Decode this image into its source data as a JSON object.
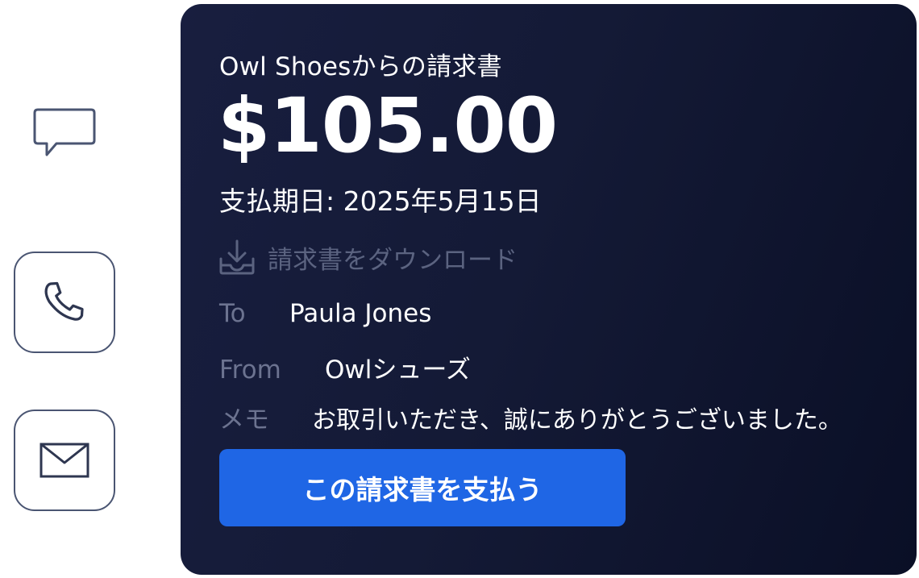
{
  "invoice": {
    "title": "Owl Shoesからの請求書",
    "amount": "$105.00",
    "due_date": "支払期日: 2025年5月15日",
    "download_label": "請求書をダウンロード",
    "to_label": "To",
    "to_value": "Paula Jones",
    "from_label": "From",
    "from_value": "Owlシューズ",
    "memo_label": "メモ",
    "memo_value": "お取引いただき、誠にありがとうございました。",
    "pay_button_label": "この請求書を支払う"
  },
  "side_icons": [
    "chat-icon",
    "phone-icon",
    "mail-icon"
  ],
  "colors": {
    "card_background": "#141a36",
    "pay_button": "#1f66e5",
    "muted_text": "#6c7390",
    "icon_stroke": "#4a5572"
  }
}
